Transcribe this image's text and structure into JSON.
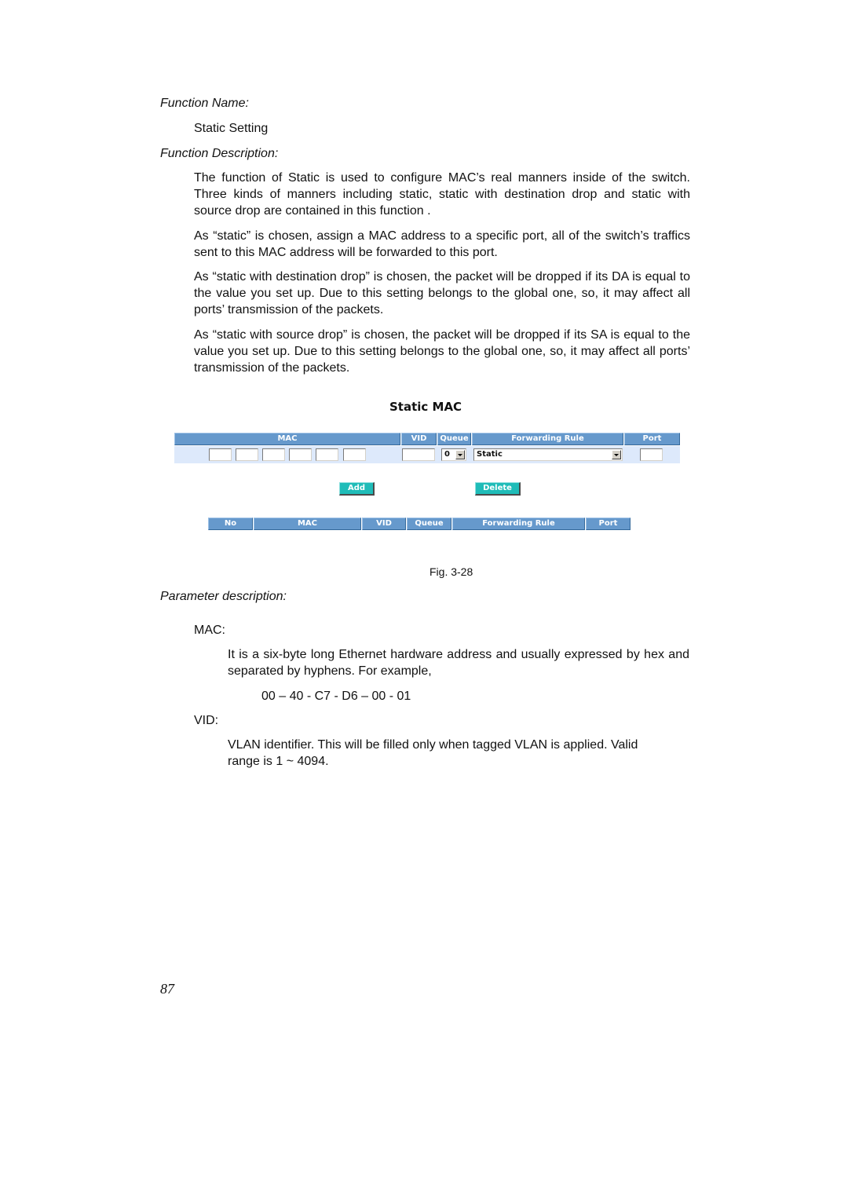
{
  "doc": {
    "function_name_label": "Function Name:",
    "function_name": "Static Setting",
    "function_description_label": "Function Description:",
    "paragraphs": [
      "The function of Static is used to configure MAC’s real manners inside of the switch. Three kinds of manners including static, static with destination drop and static with source drop are contained in this function .",
      "As “static” is chosen, assign a MAC address to a specific port, all of the switch’s traffics sent to this MAC address will be forwarded to this port.",
      "As “static with destination drop” is chosen, the packet will be dropped if its DA is equal to the value you set up. Due to this setting belongs to the global one, so, it may affect all ports’ transmission of the packets.",
      "As “static with source drop” is chosen, the packet will be dropped if its SA is equal to the value you set up. Due to this setting belongs to the global one, so, it may affect all ports’ transmission of the packets."
    ],
    "figure_caption": "Fig. 3-28",
    "parameter_label": "Parameter description:",
    "params": [
      {
        "name": "MAC:",
        "desc": "It is a six-byte long Ethernet hardware address and usually expressed by hex and separated by hyphens. For example,",
        "example": "00 – 40 - C7 - D6 – 00 - 01"
      },
      {
        "name": "VID:",
        "desc": "VLAN identifier. This will be filled only when tagged VLAN is applied. Valid range is 1 ~ 4094."
      }
    ],
    "page_number": "87"
  },
  "figure": {
    "title": "Static MAC",
    "input_table": {
      "headers": [
        "MAC",
        "VID",
        "Queue",
        "Forwarding Rule",
        "Port"
      ],
      "mac_octets": [
        "",
        "",
        "",
        "",
        "",
        ""
      ],
      "vid": "",
      "queue": "0",
      "forwarding_rule": "Static",
      "port": ""
    },
    "add_label": "Add",
    "delete_label": "Delete",
    "list_table": {
      "headers": [
        "No",
        "MAC",
        "VID",
        "Queue",
        "Forwarding Rule",
        "Port"
      ]
    },
    "colors": {
      "header_bg": "#6699cc",
      "row_bg": "#dde9fb",
      "button_bg": "#1fbcb8"
    }
  }
}
